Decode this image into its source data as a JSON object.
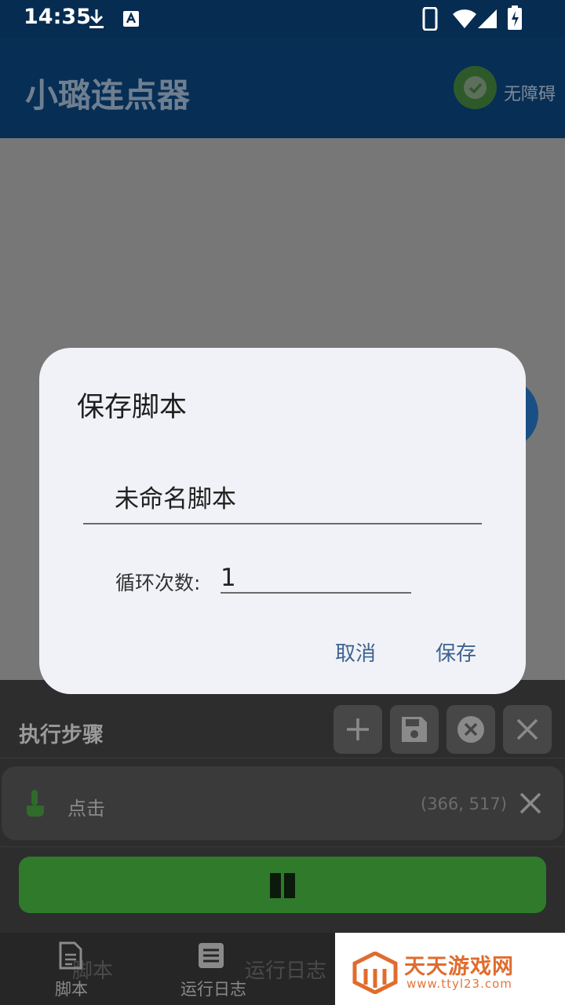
{
  "status_bar": {
    "time": "14:35",
    "left_icons": [
      "download-icon",
      "keyboard-a-icon"
    ],
    "right_icons": [
      "phone-icon",
      "wifi-icon",
      "signal-icon",
      "battery-charging-icon"
    ]
  },
  "app_bar": {
    "title": "小璐连点器",
    "accessibility_label": "无障碍",
    "accessibility_icon": "check-circle-icon"
  },
  "dialog": {
    "title": "保存脚本",
    "name_value": "未命名脚本",
    "loop_label": "循环次数:",
    "loop_value": "1",
    "cancel_label": "取消",
    "save_label": "保存"
  },
  "panel": {
    "title": "执行步骤",
    "tools": [
      "add-icon",
      "save-icon",
      "clear-icon",
      "close-icon"
    ],
    "steps": [
      {
        "label": "点击",
        "coords": "(366, 517)",
        "icon": "tap-hand-icon"
      }
    ],
    "run_icon": "play-book-icon"
  },
  "bottom_nav": {
    "items": [
      {
        "label": "脚本",
        "icon": "document-icon"
      },
      {
        "label": "运行日志",
        "icon": "log-list-icon"
      }
    ],
    "ghost_labels": [
      "脚本",
      "运行日志"
    ]
  },
  "watermark": {
    "title": "天天游戏网",
    "url": "www.ttyl23.com"
  },
  "colors": {
    "app_bar": "#072e55",
    "dialog_bg": "#f1f2f7",
    "dialog_button": "#3f6391",
    "run_button": "#2f7a2b",
    "watermark_orange": "#e06c2d"
  }
}
